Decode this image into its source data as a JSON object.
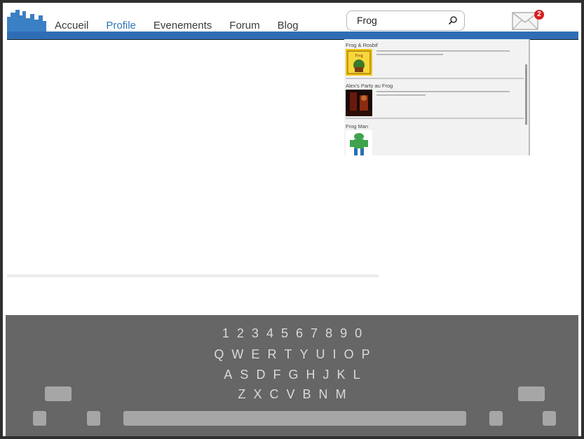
{
  "nav": {
    "items": [
      {
        "label": "Accueil",
        "active": false
      },
      {
        "label": "Profile",
        "active": true
      },
      {
        "label": "Evenements",
        "active": false
      },
      {
        "label": "Forum",
        "active": false
      },
      {
        "label": "Blog",
        "active": false
      }
    ]
  },
  "search": {
    "value": "Frog"
  },
  "mail": {
    "badge": "2"
  },
  "results": [
    {
      "title": "Frog & Rosbif",
      "thumb": "pub-sign"
    },
    {
      "title": "Alex's Party au Frog",
      "thumb": "party-photo"
    },
    {
      "title": "Frog Man",
      "thumb": "frog-character"
    }
  ],
  "keyboard": {
    "rows": [
      [
        "1",
        "2",
        "3",
        "4",
        "5",
        "6",
        "7",
        "8",
        "9",
        "0"
      ],
      [
        "Q",
        "W",
        "E",
        "R",
        "T",
        "Y",
        "U",
        "I",
        "O",
        "P"
      ],
      [
        "A",
        "S",
        "D",
        "F",
        "G",
        "H",
        "J",
        "K",
        "L"
      ],
      [
        "Z",
        "X",
        "C",
        "V",
        "B",
        "N",
        "M"
      ]
    ]
  },
  "colors": {
    "accent": "#2e74b5",
    "bar": "#2e6db5",
    "badge": "#d81e1e",
    "keyboard": "#666666"
  }
}
